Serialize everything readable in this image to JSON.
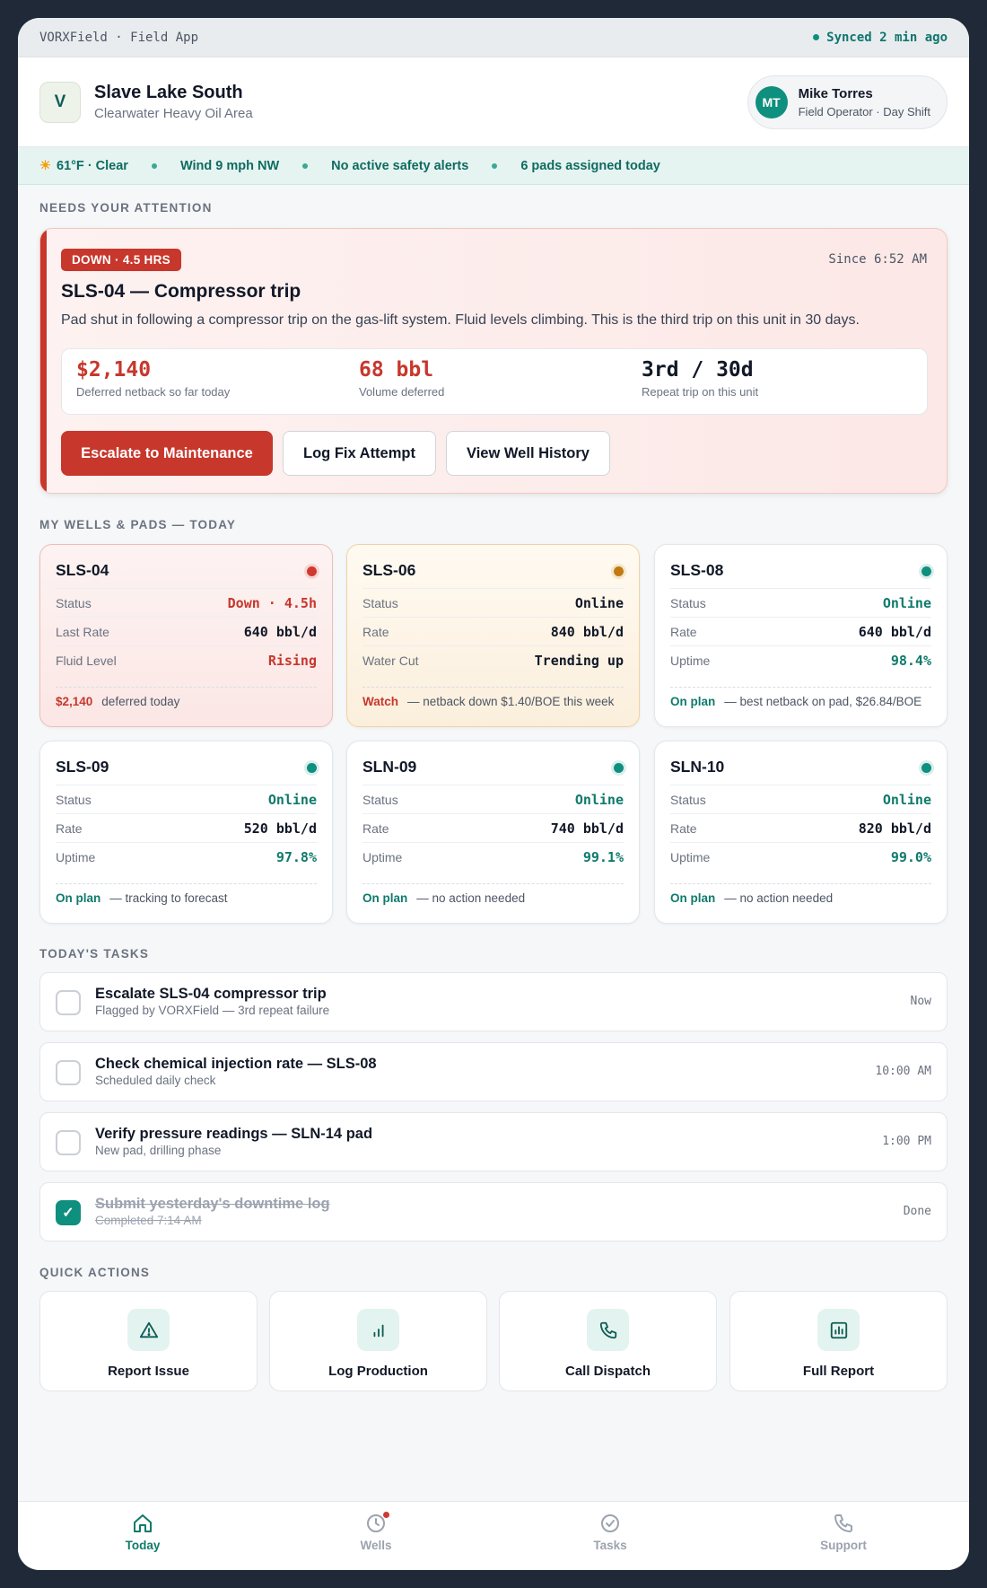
{
  "statusbar": {
    "app": "VORXField · Field App",
    "sync": "Synced 2 min ago"
  },
  "header": {
    "logo_letter": "V",
    "site": "Slave Lake South",
    "area": "Clearwater Heavy Oil Area",
    "user": {
      "initials": "MT",
      "name": "Mike Torres",
      "role": "Field Operator · Day Shift"
    }
  },
  "conditions": {
    "weather": "61°F · Clear",
    "wind": "Wind 9 mph NW",
    "safety": "No active safety alerts",
    "pads": "6 pads assigned today"
  },
  "sections": {
    "attention": "NEEDS YOUR ATTENTION",
    "wells": "MY WELLS & PADS — TODAY",
    "tasks": "TODAY'S TASKS",
    "quick": "QUICK ACTIONS"
  },
  "alert": {
    "badge": "DOWN · 4.5 HRS",
    "since": "Since 6:52 AM",
    "title": "SLS-04 — Compressor trip",
    "desc": "Pad shut in following a compressor trip on the gas-lift system. Fluid levels climbing. This is the third trip on this unit in 30 days.",
    "metrics": [
      {
        "value": "$2,140",
        "label": "Deferred netback so far today"
      },
      {
        "value": "68 bbl",
        "label": "Volume deferred"
      },
      {
        "value": "3rd / 30d",
        "label": "Repeat trip on this unit"
      }
    ],
    "buttons": {
      "escalate": "Escalate to Maintenance",
      "log": "Log Fix Attempt",
      "history": "View Well History"
    }
  },
  "wells": [
    {
      "name": "SLS-04",
      "status_color": "red",
      "rows": [
        {
          "k": "Status",
          "v": "Down · 4.5h"
        },
        {
          "k": "Last Rate",
          "v": "640 bbl/d"
        },
        {
          "k": "Fluid Level",
          "v": "Rising"
        }
      ],
      "foot_b": "$2,140",
      "foot": "deferred today"
    },
    {
      "name": "SLS-06",
      "status_color": "amber",
      "rows": [
        {
          "k": "Status",
          "v": "Online"
        },
        {
          "k": "Rate",
          "v": "840 bbl/d"
        },
        {
          "k": "Water Cut",
          "v": "Trending up"
        }
      ],
      "foot_b": "Watch",
      "foot": "— netback down $1.40/BOE this week"
    },
    {
      "name": "SLS-08",
      "status_color": "green",
      "rows": [
        {
          "k": "Status",
          "v": "Online"
        },
        {
          "k": "Rate",
          "v": "640 bbl/d"
        },
        {
          "k": "Uptime",
          "v": "98.4%"
        }
      ],
      "foot_b": "On plan",
      "foot": "— best netback on pad, $26.84/BOE"
    },
    {
      "name": "SLS-09",
      "status_color": "green",
      "rows": [
        {
          "k": "Status",
          "v": "Online"
        },
        {
          "k": "Rate",
          "v": "520 bbl/d"
        },
        {
          "k": "Uptime",
          "v": "97.8%"
        }
      ],
      "foot_b": "On plan",
      "foot": "— tracking to forecast"
    },
    {
      "name": "SLN-09",
      "status_color": "green",
      "rows": [
        {
          "k": "Status",
          "v": "Online"
        },
        {
          "k": "Rate",
          "v": "740 bbl/d"
        },
        {
          "k": "Uptime",
          "v": "99.1%"
        }
      ],
      "foot_b": "On plan",
      "foot": "— no action needed"
    },
    {
      "name": "SLN-10",
      "status_color": "green",
      "rows": [
        {
          "k": "Status",
          "v": "Online"
        },
        {
          "k": "Rate",
          "v": "820 bbl/d"
        },
        {
          "k": "Uptime",
          "v": "99.0%"
        }
      ],
      "foot_b": "On plan",
      "foot": "— no action needed"
    }
  ],
  "tasks": [
    {
      "title": "Escalate SLS-04 compressor trip",
      "sub": "Flagged by VORXField — 3rd repeat failure",
      "time": "Now",
      "done": false
    },
    {
      "title": "Check chemical injection rate — SLS-08",
      "sub": "Scheduled daily check",
      "time": "10:00 AM",
      "done": false
    },
    {
      "title": "Verify pressure readings — SLN-14 pad",
      "sub": "New pad, drilling phase",
      "time": "1:00 PM",
      "done": false
    },
    {
      "title": "Submit yesterday's downtime log",
      "sub": "Completed 7:14 AM",
      "time": "Done",
      "done": true,
      "check": "✓"
    }
  ],
  "quick_actions": [
    {
      "label": "Report Issue",
      "icon": "warning-icon"
    },
    {
      "label": "Log Production",
      "icon": "bar-chart-icon"
    },
    {
      "label": "Call Dispatch",
      "icon": "phone-icon"
    },
    {
      "label": "Full Report",
      "icon": "report-icon"
    }
  ],
  "nav": [
    {
      "label": "Today",
      "icon": "home-icon",
      "active": true
    },
    {
      "label": "Wells",
      "icon": "clock-icon",
      "badge": true
    },
    {
      "label": "Tasks",
      "icon": "check-circle-icon"
    },
    {
      "label": "Support",
      "icon": "phone-icon"
    }
  ],
  "colors": {
    "accent": "#0f8f7e",
    "danger": "#c7372c",
    "warning": "#c07a10"
  }
}
